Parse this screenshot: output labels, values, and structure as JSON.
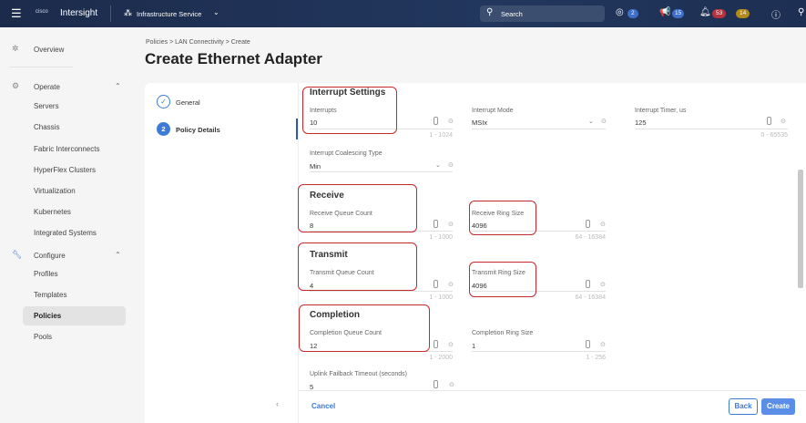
{
  "header": {
    "app_name": "Intersight",
    "service": "Infrastructure Service",
    "search_placeholder": "Search",
    "tasks_count": "2",
    "announcements_count": "15",
    "alarms_critical": "53",
    "alarms_warning": "14"
  },
  "sidebar": {
    "overview": "Overview",
    "operate": "Operate",
    "operate_items": [
      "Servers",
      "Chassis",
      "Fabric Interconnects",
      "HyperFlex Clusters",
      "Virtualization",
      "Kubernetes",
      "Integrated Systems"
    ],
    "configure": "Configure",
    "configure_items": [
      "Profiles",
      "Templates",
      "Policies",
      "Pools"
    ]
  },
  "breadcrumb": [
    "Policies",
    "LAN Connectivity",
    "Create"
  ],
  "page_title": "Create Ethernet Adapter",
  "steps": [
    {
      "num": "1",
      "label": "General"
    },
    {
      "num": "2",
      "label": "Policy Details"
    }
  ],
  "form": {
    "interrupt_heading": "Interrupt Settings",
    "interrupts": {
      "label": "Interrupts",
      "value": "10",
      "range": "1 - 1024"
    },
    "interrupt_mode": {
      "label": "Interrupt Mode",
      "value": "MSIx"
    },
    "interrupt_timer": {
      "label": "Interrupt Timer, us",
      "value": "125",
      "range": "0 - 65535"
    },
    "coalescing": {
      "label": "Interrupt Coalescing Type",
      "value": "Min"
    },
    "receive_heading": "Receive",
    "rx_queue": {
      "label": "Receive Queue Count",
      "value": "8",
      "range": "1 - 1000"
    },
    "rx_ring": {
      "label": "Receive Ring Size",
      "value": "4096",
      "range": "64 - 16384"
    },
    "transmit_heading": "Transmit",
    "tx_queue": {
      "label": "Transmit Queue Count",
      "value": "4",
      "range": "1 - 1000"
    },
    "tx_ring": {
      "label": "Transmit Ring Size",
      "value": "4096",
      "range": "64 - 16384"
    },
    "completion_heading": "Completion",
    "cq_count": {
      "label": "Completion Queue Count",
      "value": "12",
      "range": "1 - 2000"
    },
    "cq_ring": {
      "label": "Completion Ring Size",
      "value": "1",
      "range": "1 - 256"
    },
    "uplink": {
      "label": "Uplink Failback Timeout (seconds)",
      "value": "5"
    }
  },
  "footer": {
    "cancel": "Cancel",
    "back": "Back",
    "create": "Create"
  }
}
